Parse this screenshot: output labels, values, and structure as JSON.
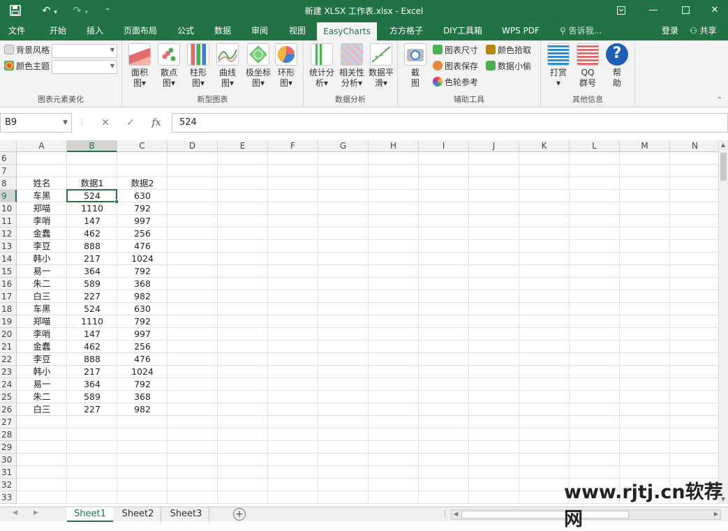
{
  "window": {
    "title": "新建 XLSX 工作表.xlsx - Excel",
    "save_icon": "save-icon",
    "undo_icon": "undo-icon",
    "redo_icon": "redo-icon",
    "customize_icon": "customize-qat-icon"
  },
  "menu": {
    "tabs": [
      "文件",
      "开始",
      "插入",
      "页面布局",
      "公式",
      "数据",
      "审阅",
      "视图",
      "EasyCharts",
      "方方格子",
      "DIY工具箱",
      "WPS PDF"
    ],
    "tell_me": "告诉我...",
    "login": "登录",
    "share": "共享"
  },
  "ribbon": {
    "beautify": {
      "bg_style": "背景风格",
      "color_theme": "颜色主题",
      "label": "图表元素美化"
    },
    "new_charts": {
      "label": "新型图表",
      "buttons": [
        {
          "line1": "面积",
          "line2": "图▾"
        },
        {
          "line1": "散点",
          "line2": "图▾"
        },
        {
          "line1": "柱形",
          "line2": "图▾"
        },
        {
          "line1": "曲线",
          "line2": "图▾"
        },
        {
          "line1": "极坐标",
          "line2": "图▾"
        },
        {
          "line1": "环形",
          "line2": "图▾"
        }
      ]
    },
    "analysis": {
      "label": "数据分析",
      "buttons": [
        {
          "line1": "统计分",
          "line2": "析▾"
        },
        {
          "line1": "相关性",
          "line2": "分析▾"
        },
        {
          "line1": "数据平",
          "line2": "滑▾"
        }
      ]
    },
    "tools": {
      "label": "辅助工具",
      "screenshot_1": "截",
      "screenshot_2": "图",
      "chart_size": "图表尺寸",
      "chart_save": "图表保存",
      "color_ref": "色轮参考",
      "color_pick": "颜色拾取",
      "data_thief": "数据小偷"
    },
    "other": {
      "label": "其他信息",
      "reward_1": "打赏",
      "reward_2": "▾",
      "qq_1": "QQ",
      "qq_2": "群号",
      "help_1": "帮",
      "help_2": "助"
    }
  },
  "formula_bar": {
    "name_box": "B9",
    "cancel": "✕",
    "enter": "✓",
    "fx": "fx",
    "value": "524"
  },
  "grid": {
    "columns": [
      "A",
      "B",
      "C",
      "D",
      "E",
      "F",
      "G",
      "H",
      "I",
      "J",
      "K",
      "L",
      "M",
      "N"
    ],
    "rows": [
      "6",
      "7",
      "8",
      "9",
      "10",
      "11",
      "12",
      "13",
      "14",
      "15",
      "16",
      "17",
      "18",
      "19",
      "20",
      "21",
      "22",
      "23",
      "24",
      "25",
      "26",
      "27",
      "28",
      "29",
      "30",
      "31",
      "32",
      "33"
    ],
    "selected_cell": "B9",
    "header": {
      "name": "姓名",
      "col1": "数据1",
      "col2": "数据2"
    },
    "data": [
      [
        "车黑",
        "524",
        "630"
      ],
      [
        "郑喵",
        "1110",
        "792"
      ],
      [
        "李哨",
        "147",
        "997"
      ],
      [
        "金蠢",
        "462",
        "256"
      ],
      [
        "李豆",
        "888",
        "476"
      ],
      [
        "韩小",
        "217",
        "1024"
      ],
      [
        "易一",
        "364",
        "792"
      ],
      [
        "朱二",
        "589",
        "368"
      ],
      [
        "白三",
        "227",
        "982"
      ],
      [
        "车黑",
        "524",
        "630"
      ],
      [
        "郑喵",
        "1110",
        "792"
      ],
      [
        "李哨",
        "147",
        "997"
      ],
      [
        "金蠢",
        "462",
        "256"
      ],
      [
        "李豆",
        "888",
        "476"
      ],
      [
        "韩小",
        "217",
        "1024"
      ],
      [
        "易一",
        "364",
        "792"
      ],
      [
        "朱二",
        "589",
        "368"
      ],
      [
        "白三",
        "227",
        "982"
      ]
    ]
  },
  "sheets": [
    "Sheet1",
    "Sheet2",
    "Sheet3"
  ],
  "active_sheet": "Sheet1",
  "watermark": "www.rjtj.cn软荐网",
  "colors": {
    "accent": "#217346",
    "ribbon_bg": "#f3f3f3"
  }
}
